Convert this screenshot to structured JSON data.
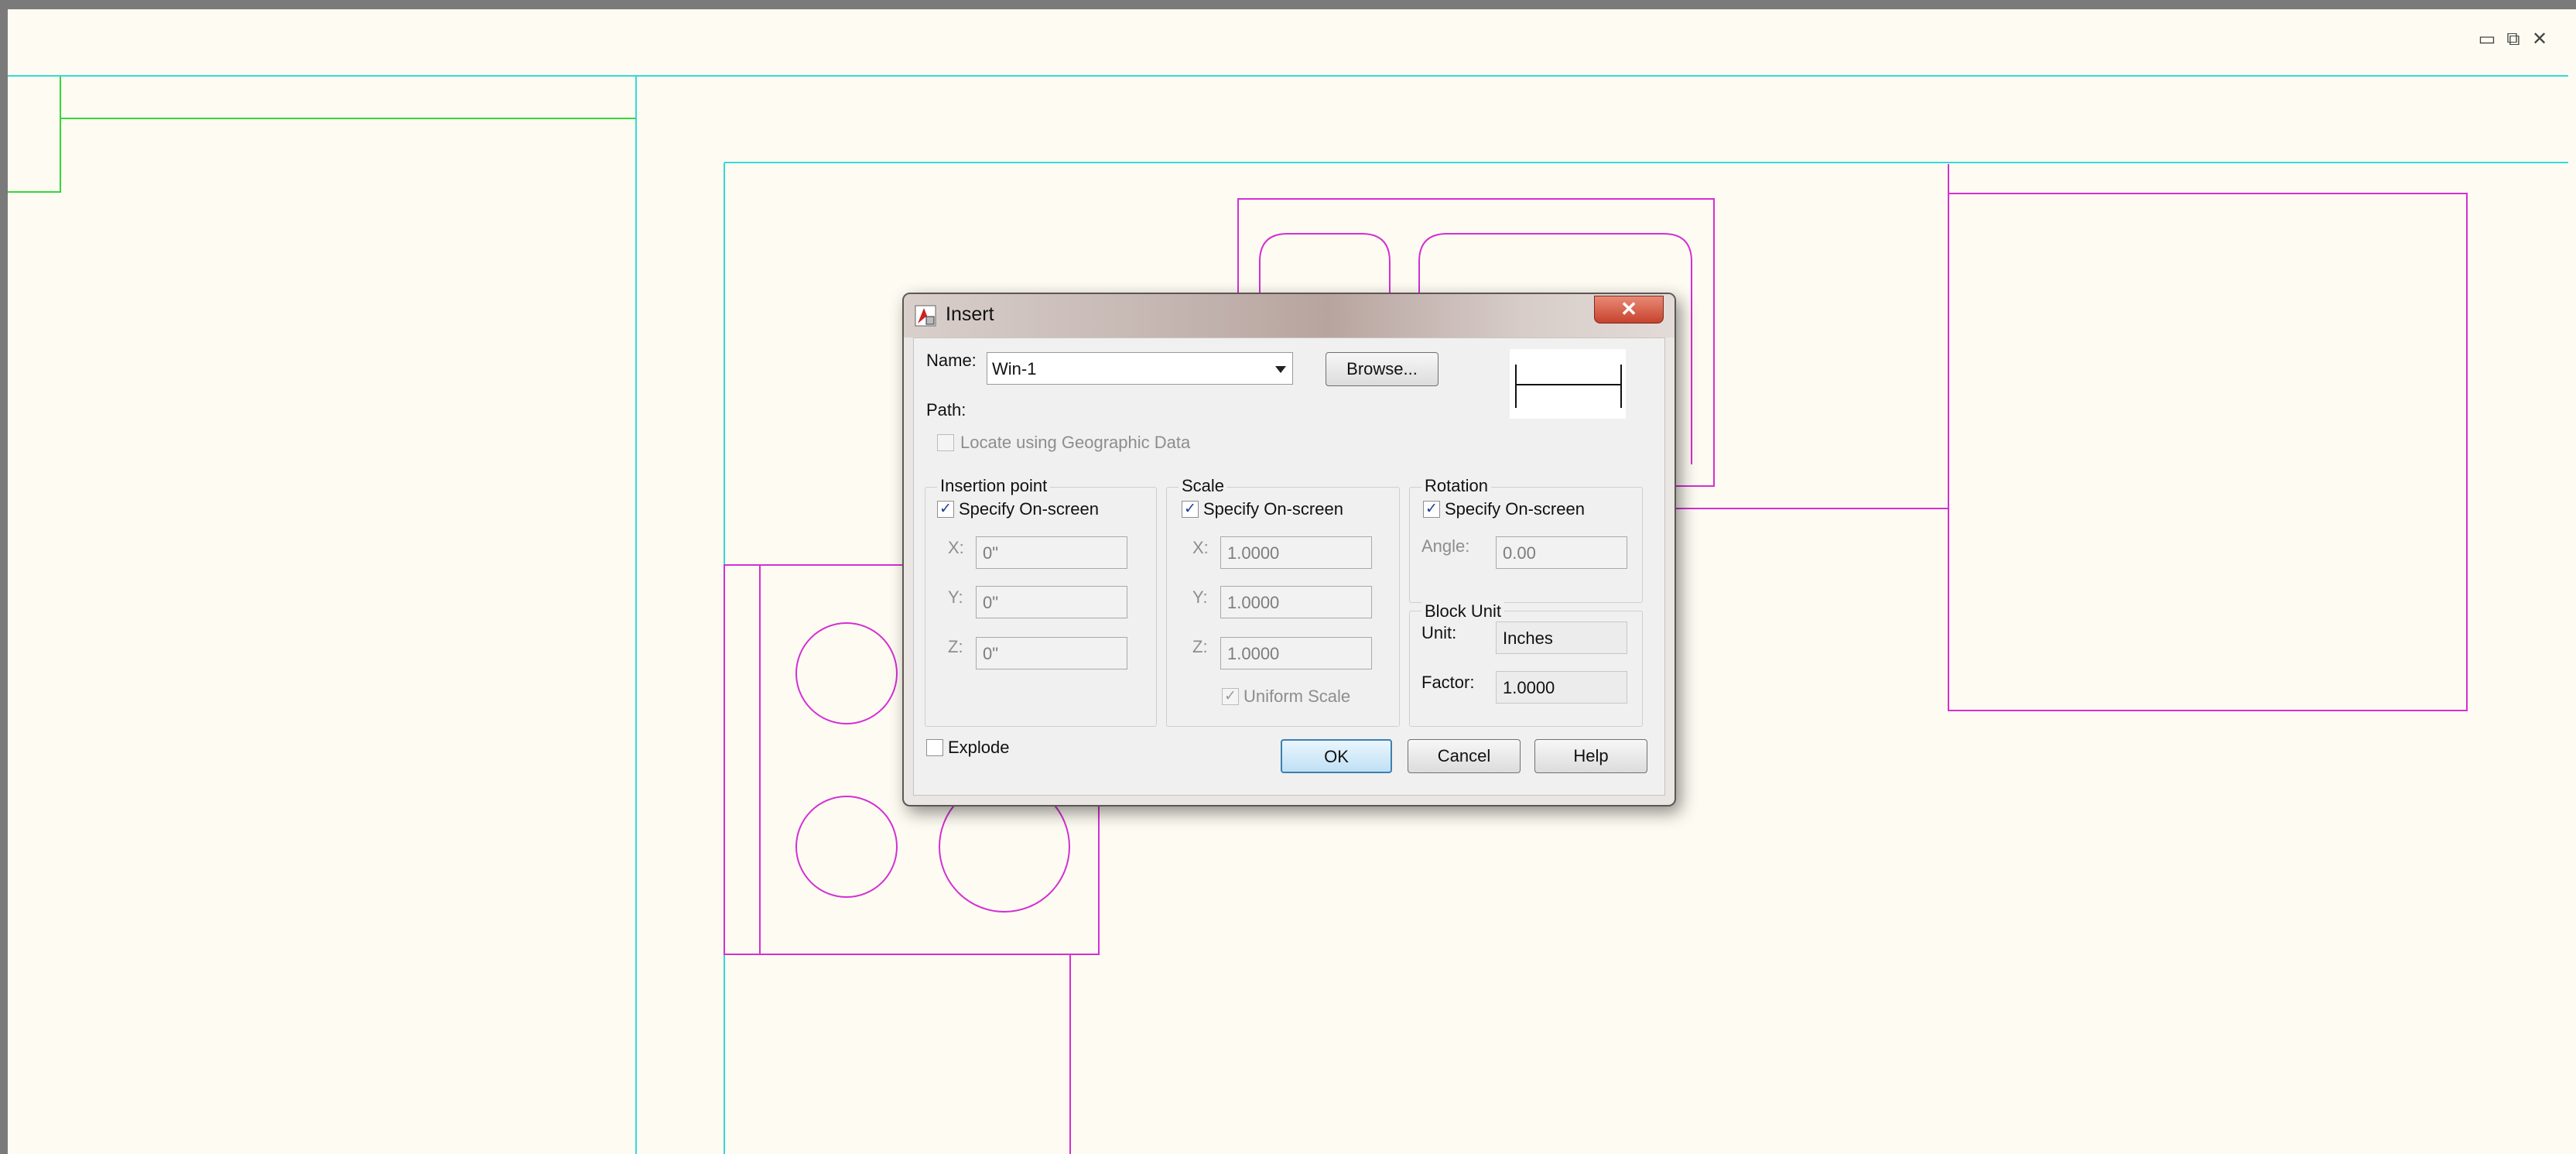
{
  "window_controls": {
    "minimize": "▭",
    "restore": "⧉",
    "close": "✕"
  },
  "colors": {
    "canvas_bg": "#fefcf2",
    "cyan_lines": "#33dada",
    "magenta_lines": "#d42fd4",
    "green_lines": "#37d637"
  },
  "dialog": {
    "title": "Insert",
    "close_glyph": "✕",
    "name_label": "Name:",
    "name_value": "Win-1",
    "browse_label": "Browse...",
    "path_label": "Path:",
    "geo_label": "Locate using Geographic Data",
    "geo_checked": false,
    "insertion": {
      "title": "Insertion point",
      "specify_label": "Specify On-screen",
      "specify_checked": true,
      "x_label": "X:",
      "x_value": "0\"",
      "y_label": "Y:",
      "y_value": "0\"",
      "z_label": "Z:",
      "z_value": "0\""
    },
    "scale": {
      "title": "Scale",
      "specify_label": "Specify On-screen",
      "specify_checked": true,
      "x_label": "X:",
      "x_value": "1.0000",
      "y_label": "Y:",
      "y_value": "1.0000",
      "z_label": "Z:",
      "z_value": "1.0000",
      "uniform_label": "Uniform Scale",
      "uniform_checked": true
    },
    "rotation": {
      "title": "Rotation",
      "specify_label": "Specify On-screen",
      "specify_checked": true,
      "angle_label": "Angle:",
      "angle_value": "0.00"
    },
    "block_unit": {
      "title": "Block Unit",
      "unit_label": "Unit:",
      "unit_value": "Inches",
      "factor_label": "Factor:",
      "factor_value": "1.0000"
    },
    "explode_label": "Explode",
    "explode_checked": false,
    "ok_label": "OK",
    "cancel_label": "Cancel",
    "help_label": "Help"
  }
}
